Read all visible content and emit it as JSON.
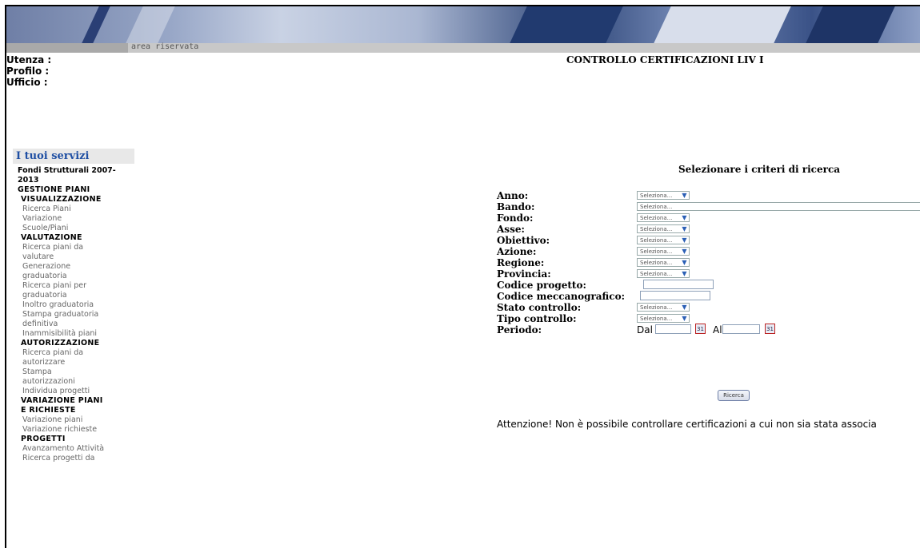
{
  "header": {
    "area_label": "area riservata"
  },
  "user": {
    "utenza_label": "Utenza :",
    "profilo_label": "Profilo :",
    "ufficio_label": "Ufficio :"
  },
  "page_title": "CONTROLLO CERTIFICAZIONI LIV I",
  "sidebar": {
    "title": "I tuoi servizi",
    "section": "Fondi Strutturali 2007-2013",
    "group1": "GESTIONE PIANI",
    "sub1": "VISUALIZZAZIONE",
    "sub1_links": [
      "Ricerca Piani",
      "Variazione",
      "Scuole/Piani"
    ],
    "sub2": "VALUTAZIONE",
    "sub2_links": [
      "Ricerca piani da",
      "valutare",
      "Generazione",
      "graduatoria",
      "Ricerca piani per",
      "graduatoria",
      "Inoltro graduatoria",
      "Stampa graduatoria",
      "definitiva",
      "Inammisibilità piani"
    ],
    "sub3": "AUTORIZZAZIONE",
    "sub3_links": [
      "Ricerca piani da",
      "autorizzare",
      "Stampa",
      "autorizzazioni",
      "Individua progetti"
    ],
    "sub4a": "VARIAZIONE PIANI",
    "sub4b": "E RICHIESTE",
    "sub4_links": [
      "Variazione piani",
      "Variazione richieste"
    ],
    "sub5": "PROGETTI",
    "sub5_links": [
      "Avanzamento Attività",
      "Ricerca progetti da"
    ]
  },
  "form": {
    "title": "Selezionare i criteri di ricerca",
    "anno": "Anno:",
    "bando": "Bando:",
    "fondo": "Fondo:",
    "asse": "Asse:",
    "obiettivo": "Obiettivo:",
    "azione": "Azione:",
    "regione": "Regione:",
    "provincia": "Provincia:",
    "codice_progetto": "Codice progetto:",
    "codice_mecc": "Codice meccanografico:",
    "stato": "Stato controllo:",
    "tipo": "Tipo controllo:",
    "periodo": "Periodo:",
    "select_value": "Seleziona...",
    "dal": "Dal",
    "al": "Al",
    "cal_icon_text": "31",
    "search_button": "Ricerca"
  },
  "warning": "Attenzione! Non è possibile controllare certificazioni a cui non sia stata associa"
}
